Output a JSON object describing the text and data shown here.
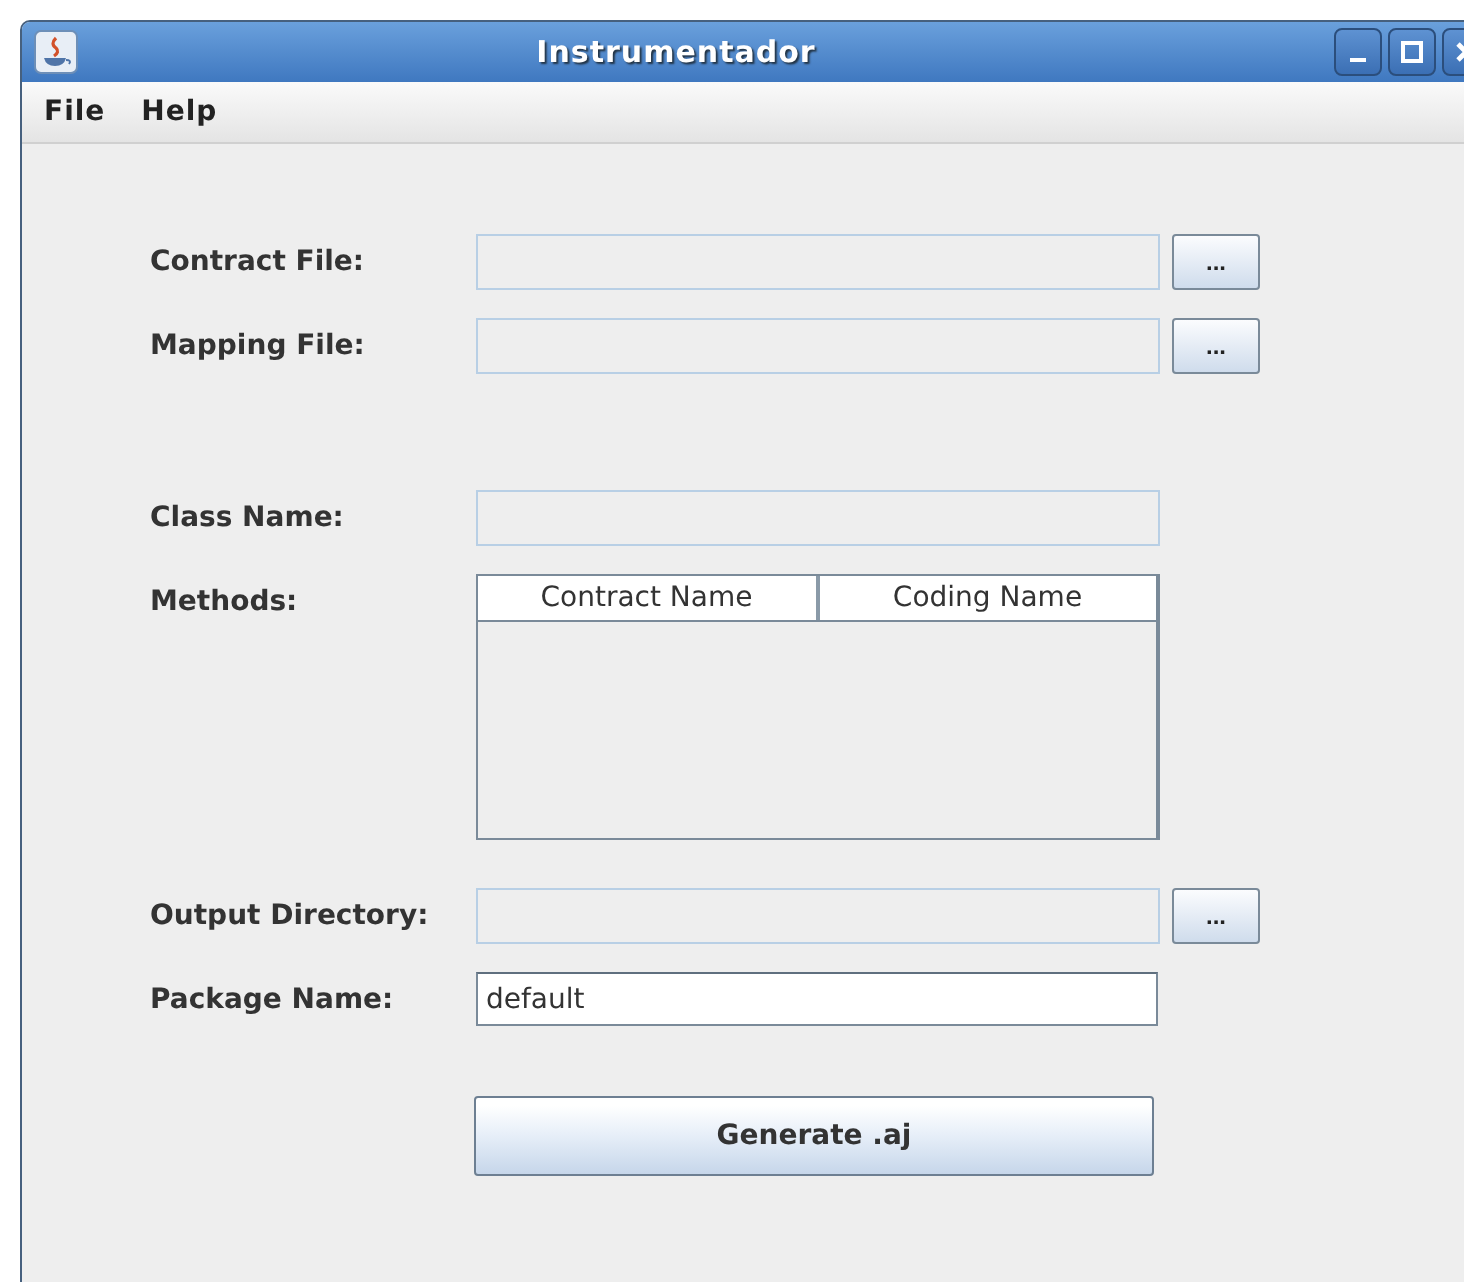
{
  "window": {
    "title": "Instrumentador"
  },
  "menu": [
    {
      "label": "File"
    },
    {
      "label": "Help"
    }
  ],
  "sections": [
    {
      "rows": [
        {
          "kind": "file",
          "label": "Contract File:",
          "value": "",
          "disabled": true,
          "browse": "..."
        },
        {
          "kind": "file",
          "label": "Mapping File:",
          "value": "",
          "disabled": true,
          "browse": "..."
        }
      ]
    },
    {
      "rows": [
        {
          "kind": "text",
          "label": "Class Name:",
          "value": "",
          "disabled": true
        },
        {
          "kind": "table",
          "label": "Methods:",
          "columns": [
            "Contract Name",
            "Coding Name"
          ]
        },
        {
          "kind": "file",
          "label": "Output Directory:",
          "value": "",
          "disabled": true,
          "browse": "..."
        },
        {
          "kind": "text",
          "label": "Package Name:",
          "value": "default",
          "disabled": false
        }
      ]
    }
  ],
  "generate_button": "Generate .aj"
}
